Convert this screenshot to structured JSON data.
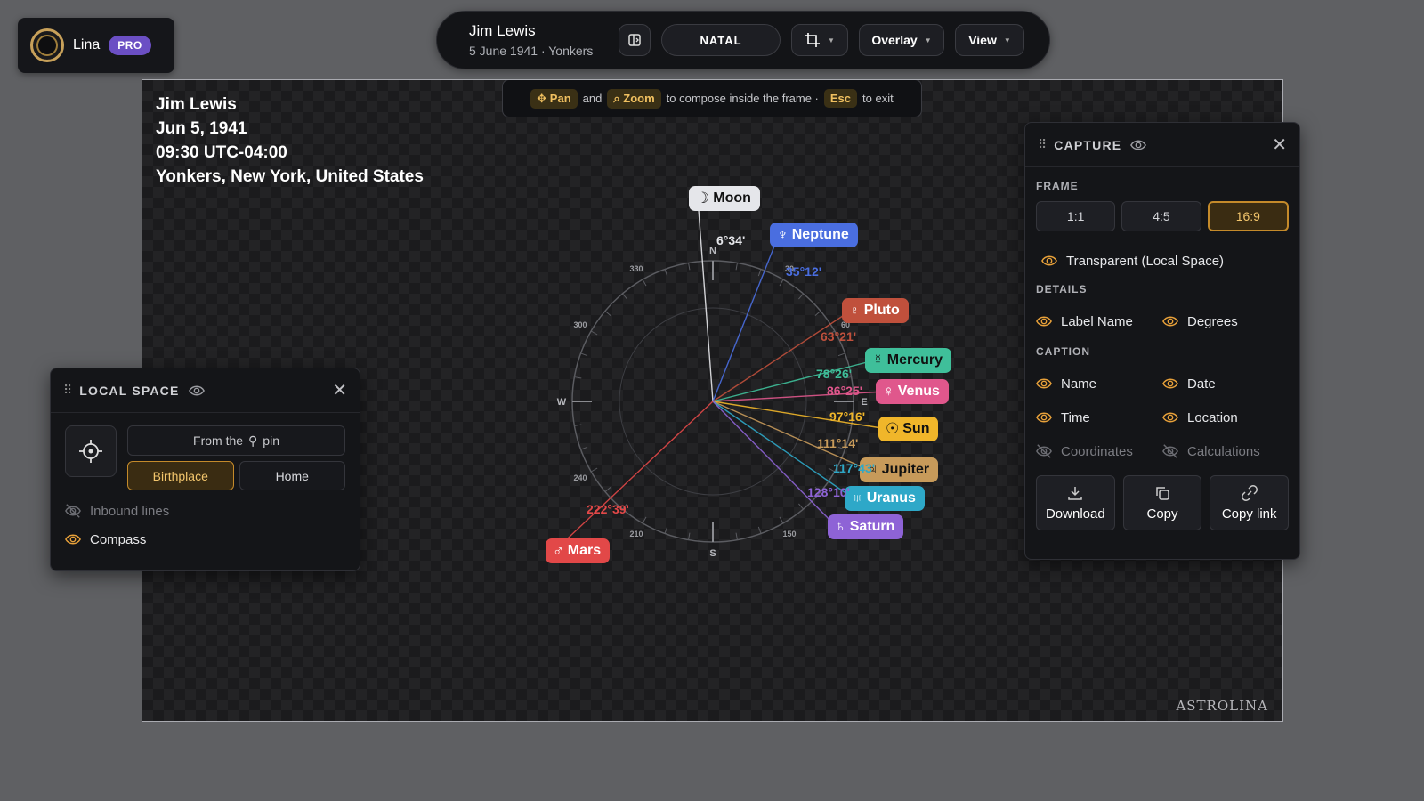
{
  "user": {
    "name": "Lina",
    "badge": "PRO"
  },
  "toolbar": {
    "person_name": "Jim Lewis",
    "person_sub": "5 June 1941 · Yonkers",
    "chart_type": "NATAL",
    "overlay_label": "Overlay",
    "view_label": "View"
  },
  "canvas": {
    "caption": {
      "name": "Jim Lewis",
      "date": "Jun 5, 1941",
      "time": "09:30 UTC-04:00",
      "location": "Yonkers, New York, United States"
    },
    "hint": {
      "pan": "Pan",
      "and": "and",
      "zoom": "Zoom",
      "middle": "to compose inside the frame ·",
      "esc": "Esc",
      "end": "to exit"
    },
    "watermark": "ASTROLINA",
    "compass": {
      "cardinals": {
        "n": "N",
        "e": "E",
        "s": "S",
        "w": "W"
      },
      "ticks": [
        "30",
        "60",
        "150",
        "210",
        "240",
        "300",
        "330"
      ]
    },
    "planets": [
      {
        "name": "Moon",
        "glyph": "☽",
        "degrees": "6°34'",
        "azimuth": 6.57,
        "color": "#e5e6ea",
        "text": "#111111"
      },
      {
        "name": "Neptune",
        "glyph": "♆",
        "degrees": "35°12'",
        "azimuth": 35.2,
        "color": "#4a6ee0",
        "text": "#ffffff"
      },
      {
        "name": "Pluto",
        "glyph": "♇",
        "degrees": "63°21'",
        "azimuth": 63.35,
        "color": "#c0503c",
        "text": "#ffffff"
      },
      {
        "name": "Mercury",
        "glyph": "☿",
        "degrees": "78°26'",
        "azimuth": 78.43,
        "color": "#3fbf9a",
        "text": "#111111"
      },
      {
        "name": "Venus",
        "glyph": "♀",
        "degrees": "86°25'",
        "azimuth": 86.42,
        "color": "#e0578c",
        "text": "#ffffff"
      },
      {
        "name": "Sun",
        "glyph": "☉",
        "degrees": "97°16'",
        "azimuth": 97.27,
        "color": "#f0b62a",
        "text": "#111111"
      },
      {
        "name": "Jupiter",
        "glyph": "♃",
        "degrees": "111°14'",
        "azimuth": 111.23,
        "color": "#c79a5a",
        "text": "#111111"
      },
      {
        "name": "Uranus",
        "glyph": "♅",
        "degrees": "117°43'",
        "azimuth": 117.72,
        "color": "#2ea8c8",
        "text": "#ffffff"
      },
      {
        "name": "Saturn",
        "glyph": "♄",
        "degrees": "128°10'",
        "azimuth": 128.17,
        "color": "#8e63d6",
        "text": "#ffffff"
      },
      {
        "name": "Mars",
        "glyph": "♂",
        "degrees": "222°39'",
        "azimuth": 222.65,
        "color": "#e24848",
        "text": "#ffffff"
      }
    ]
  },
  "local_space": {
    "title": "LOCAL SPACE",
    "from_label": "From the",
    "pin_label": "pin",
    "birthplace": "Birthplace",
    "home": "Home",
    "inbound": "Inbound lines",
    "compass": "Compass"
  },
  "capture": {
    "title": "CAPTURE",
    "frame_label": "FRAME",
    "ratios": [
      "1:1",
      "4:5",
      "16:9"
    ],
    "transparent": "Transparent (Local Space)",
    "details_label": "DETAILS",
    "label_name": "Label Name",
    "degrees": "Degrees",
    "caption_label": "CAPTION",
    "name": "Name",
    "date": "Date",
    "time": "Time",
    "location": "Location",
    "coordinates": "Coordinates",
    "calculations": "Calculations",
    "download": "Download",
    "copy": "Copy",
    "copy_link": "Copy link"
  },
  "colors": {
    "accent": "#c48a2a",
    "pro": "#6b4fc4",
    "eye_on": "#e8a13a"
  }
}
